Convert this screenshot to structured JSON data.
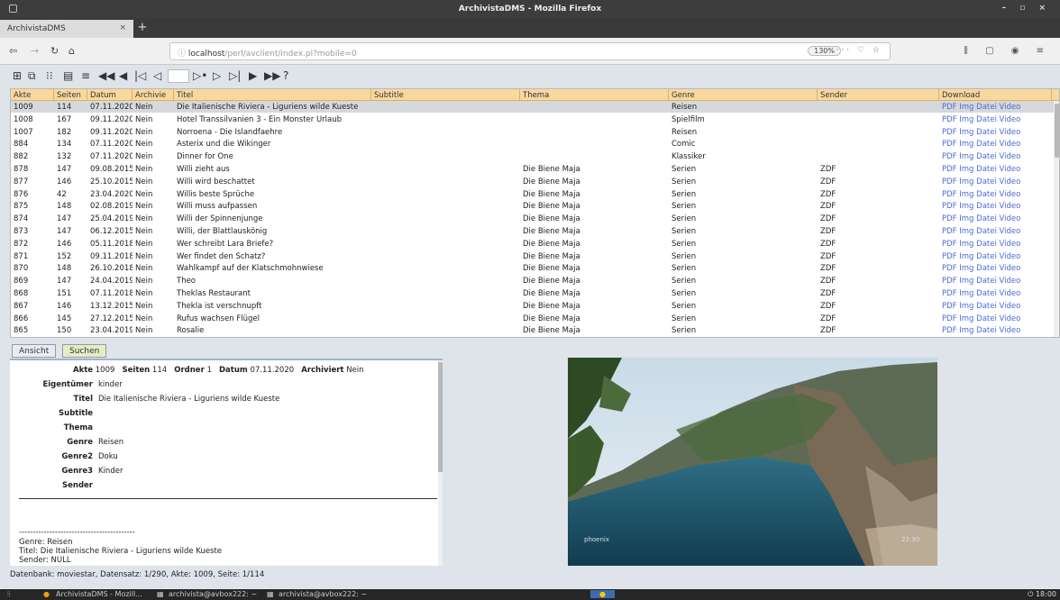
{
  "window": {
    "title": "ArchivistaDMS - Mozilla Firefox"
  },
  "browser": {
    "tab_title": "ArchivistaDMS",
    "url_host": "localhost",
    "url_path": "/perl/avclient/index.pl?mobile=0",
    "zoom": "130%"
  },
  "grid": {
    "headers": [
      "Akte",
      "Seiten",
      "Datum",
      "Archivie",
      "Titel",
      "Subtitle",
      "Thema",
      "Genre",
      "Sender",
      "Download"
    ],
    "download_links": [
      "PDF",
      "Img",
      "Datei",
      "Video"
    ],
    "rows": [
      [
        "1009",
        "114",
        "07.11.2020",
        "Nein",
        "Die Italienische Riviera - Liguriens wilde Kueste",
        "",
        "",
        "Reisen",
        ""
      ],
      [
        "1008",
        "167",
        "09.11.2020",
        "Nein",
        "Hotel Transsilvanien 3 - Ein Monster Urlaub",
        "",
        "",
        "Spielfilm",
        ""
      ],
      [
        "1007",
        "182",
        "09.11.2020",
        "Nein",
        "Norroena - Die Islandfaehre",
        "",
        "",
        "Reisen",
        ""
      ],
      [
        "884",
        "134",
        "07.11.2020",
        "Nein",
        "Asterix und die Wikinger",
        "",
        "",
        "Comic",
        ""
      ],
      [
        "882",
        "132",
        "07.11.2020",
        "Nein",
        "Dinner for One",
        "",
        "",
        "Klassiker",
        ""
      ],
      [
        "878",
        "147",
        "09.08.2015",
        "Nein",
        "Willi zieht aus",
        "",
        "Die Biene Maja",
        "Serien",
        "ZDF"
      ],
      [
        "877",
        "146",
        "25.10.2015",
        "Nein",
        "Willi wird beschattet",
        "",
        "Die Biene Maja",
        "Serien",
        "ZDF"
      ],
      [
        "876",
        "42",
        "23.04.2020",
        "Nein",
        "Willis beste Sprüche",
        "",
        "Die Biene Maja",
        "Serien",
        "ZDF"
      ],
      [
        "875",
        "148",
        "02.08.2019",
        "Nein",
        "Willi muss aufpassen",
        "",
        "Die Biene Maja",
        "Serien",
        "ZDF"
      ],
      [
        "874",
        "147",
        "25.04.2019",
        "Nein",
        "Willi der Spinnenjunge",
        "",
        "Die Biene Maja",
        "Serien",
        "ZDF"
      ],
      [
        "873",
        "147",
        "06.12.2015",
        "Nein",
        "Willi, der Blattlauskönig",
        "",
        "Die Biene Maja",
        "Serien",
        "ZDF"
      ],
      [
        "872",
        "146",
        "05.11.2018",
        "Nein",
        "Wer schreibt Lara Briefe?",
        "",
        "Die Biene Maja",
        "Serien",
        "ZDF"
      ],
      [
        "871",
        "152",
        "09.11.2018",
        "Nein",
        "Wer findet den Schatz?",
        "",
        "Die Biene Maja",
        "Serien",
        "ZDF"
      ],
      [
        "870",
        "148",
        "26.10.2018",
        "Nein",
        "Wahlkampf auf der Klatschmohnwiese",
        "",
        "Die Biene Maja",
        "Serien",
        "ZDF"
      ],
      [
        "869",
        "147",
        "24.04.2019",
        "Nein",
        "Theo",
        "",
        "Die Biene Maja",
        "Serien",
        "ZDF"
      ],
      [
        "868",
        "151",
        "07.11.2018",
        "Nein",
        "Theklas Restaurant",
        "",
        "Die Biene Maja",
        "Serien",
        "ZDF"
      ],
      [
        "867",
        "146",
        "13.12.2015",
        "Nein",
        "Thekla ist verschnupft",
        "",
        "Die Biene Maja",
        "Serien",
        "ZDF"
      ],
      [
        "866",
        "145",
        "27.12.2015",
        "Nein",
        "Rufus wachsen Flügel",
        "",
        "Die Biene Maja",
        "Serien",
        "ZDF"
      ],
      [
        "865",
        "150",
        "23.04.2019",
        "Nein",
        "Rosalie",
        "",
        "Die Biene Maja",
        "Serien",
        "ZDF"
      ]
    ]
  },
  "subtabs": {
    "ansicht": "Ansicht",
    "suchen": "Suchen"
  },
  "detail": {
    "akte_label": "Akte",
    "akte": "1009",
    "seiten_label": "Seiten",
    "seiten": "114",
    "ordner_label": "Ordner",
    "ordner": "1",
    "datum_label": "Datum",
    "datum": "07.11.2020",
    "archiviert_label": "Archiviert",
    "archiviert": "Nein",
    "eigentuemer_label": "Eigentümer",
    "eigentuemer": "kinder",
    "titel_label": "Titel",
    "titel": "Die Italienische Riviera - Liguriens wilde Kueste",
    "subtitle_label": "Subtitle",
    "thema_label": "Thema",
    "genre_label": "Genre",
    "genre": "Reisen",
    "genre2_label": "Genre2",
    "genre2": "Doku",
    "genre3_label": "Genre3",
    "genre3": "Kinder",
    "sender_label": "Sender",
    "text_sep": "------------------------------------------",
    "text_genre": "Genre: Reisen",
    "text_titel": "Titel: Die Italienische Riviera - Liguriens wilde Kueste",
    "text_sender": "Sender: NULL"
  },
  "status": "Datenbank: moviestar, Datensatz: 1/290, Akte: 1009, Seite: 1/114",
  "preview": {
    "watermark": "phoenix",
    "time": "22:30"
  },
  "taskbar": {
    "task1": "ArchivistaDMS - Mozill...",
    "task2": "archivista@avbox222: ~",
    "task3": "archivista@avbox222: ~",
    "clock": "18:00"
  }
}
